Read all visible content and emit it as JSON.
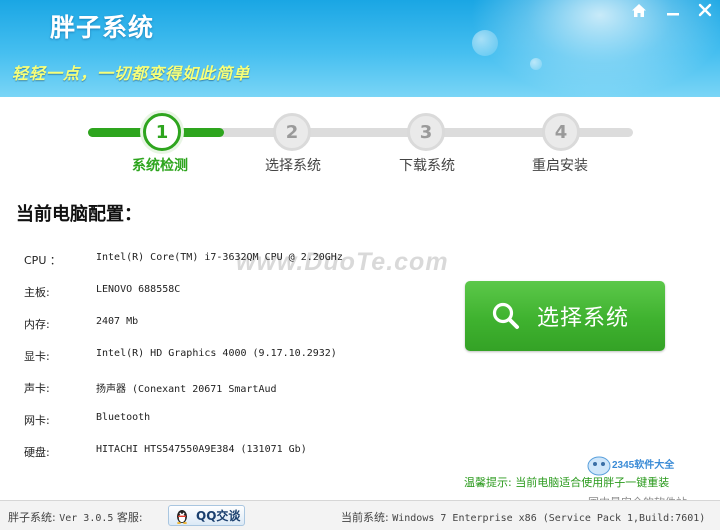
{
  "header": {
    "app_title": "胖子系统",
    "slogan": "轻轻一点，一切都变得如此简单"
  },
  "steps": [
    {
      "number": "1",
      "label": "系统检测",
      "state": "done"
    },
    {
      "number": "2",
      "label": "选择系统",
      "state": "todo"
    },
    {
      "number": "3",
      "label": "下载系统",
      "state": "todo"
    },
    {
      "number": "4",
      "label": "重启安装",
      "state": "todo"
    }
  ],
  "config": {
    "title": "当前电脑配置：",
    "rows": [
      {
        "key": "CPU ：",
        "value": "Intel(R) Core(TM) i7-3632QM CPU @ 2.20GHz"
      },
      {
        "key": "主板:",
        "value": "LENOVO 688558C"
      },
      {
        "key": "内存:",
        "value": "2407 Mb"
      },
      {
        "key": "显卡:",
        "value": "Intel(R) HD Graphics 4000 (9.17.10.2932)"
      },
      {
        "key": "声卡:",
        "value": "扬声器 (Conexant 20671 SmartAud"
      },
      {
        "key": "网卡:",
        "value": "Bluetooth"
      },
      {
        "key": "硬盘:",
        "value": "HITACHI HTS547550A9E384 (131071 Gb)"
      }
    ]
  },
  "watermark": "www.DuoTe.com",
  "main_button": {
    "label": "选择系统",
    "icon": "search-icon"
  },
  "tip": {
    "label": "温馨提示:",
    "text": "当前电脑适合使用胖子一键重装"
  },
  "corner_logo": {
    "brand": "2345软件大全",
    "tagline": "国内最安全的软件站"
  },
  "statusbar": {
    "app_name": "胖子系统:",
    "version": "Ver 3.0.5",
    "support_label": "客服:",
    "qq_button": "QQ交谈",
    "os_label": "当前系统:",
    "os_value": "Windows 7 Enterprise x86 (Service Pack 1,Build:7601)"
  },
  "colors": {
    "header_blue": "#1aa6e4",
    "accent_green": "#2ea51e",
    "button_green": "#3fb22f",
    "slogan_yellow": "#f6ff7a"
  }
}
